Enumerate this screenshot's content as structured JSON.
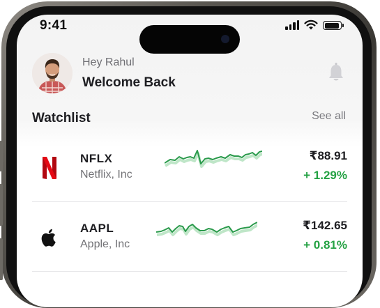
{
  "status_bar": {
    "time": "9:41",
    "icons": [
      "cellular-signal-icon",
      "wifi-icon",
      "battery-icon"
    ]
  },
  "header": {
    "greeting": "Hey Rahul",
    "title": "Welcome Back",
    "avatar": "user-avatar",
    "notification_icon": "bell-icon"
  },
  "watchlist": {
    "title": "Watchlist",
    "see_all_label": "See all",
    "accent_positive": "#25a244",
    "items": [
      {
        "ticker": "NFLX",
        "company": "Netflix, Inc",
        "price": "₹88.91",
        "change": "+ 1.29%",
        "logo": "netflix-logo-icon",
        "logo_color": "#e50914"
      },
      {
        "ticker": "AAPL",
        "company": "Apple, Inc",
        "price": "₹142.65",
        "change": "+ 0.81%",
        "logo": "apple-logo-icon",
        "logo_color": "#111111"
      }
    ]
  }
}
